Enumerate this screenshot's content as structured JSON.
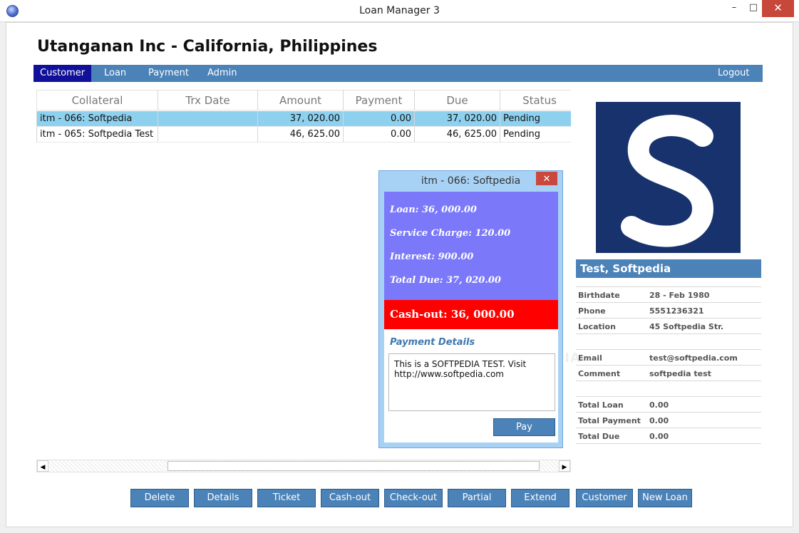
{
  "window": {
    "title": "Loan Manager 3",
    "min_glyph": "–",
    "max_glyph": "□",
    "close_glyph": "✕"
  },
  "company": "Utanganan Inc - California, Philippines",
  "nav": {
    "items": [
      "Customer",
      "Loan",
      "Payment",
      "Admin"
    ],
    "active": "Customer",
    "logout": "Logout"
  },
  "table": {
    "columns": [
      "Collateral",
      "Trx Date",
      "Amount",
      "Payment",
      "Due",
      "Status"
    ],
    "rows": [
      {
        "collateral": "itm - 066: Softpedia",
        "trx_date": "",
        "amount": "37, 020.00",
        "payment": "0.00",
        "due": "37, 020.00",
        "status": "Pending",
        "selected": true
      },
      {
        "collateral": "itm - 065: Softpedia Test",
        "trx_date": "",
        "amount": "46, 625.00",
        "payment": "0.00",
        "due": "46, 625.00",
        "status": "Pending",
        "selected": false
      }
    ]
  },
  "scrollbar": {
    "left_arrow": "◀",
    "right_arrow": "▶"
  },
  "popup": {
    "title": "itm - 066: Softpedia",
    "close_glyph": "✕",
    "loan": "Loan: 36, 000.00",
    "service_charge": "Service Charge: 120.00",
    "interest": "Interest: 900.00",
    "total_due": "Total Due: 37, 020.00",
    "cashout": "Cash-out: 36, 000.00",
    "payment_details_label": "Payment Details",
    "payment_details_text": "This is a SOFTPEDIA TEST. Visit http://www.softpedia.com",
    "pay_button": "Pay"
  },
  "customer": {
    "photo_letter": "S",
    "name": "Test, Softpedia",
    "birthdate_label": "Birthdate",
    "birthdate": "28 - Feb  1980",
    "phone_label": "Phone",
    "phone": "5551236321",
    "location_label": "Location",
    "location": "45 Softpedia Str.",
    "email_label": "Email",
    "email": "test@softpedia.com",
    "comment_label": "Comment",
    "comment": "softpedia test",
    "total_loan_label": "Total Loan",
    "total_loan": "0.00",
    "total_payment_label": "Total Payment",
    "total_payment": "0.00",
    "total_due_label": "Total Due",
    "total_due": "0.00"
  },
  "buttons": {
    "delete": "Delete",
    "details": "Details",
    "ticket": "Ticket",
    "cashout": "Cash-out",
    "checkout": "Check-out",
    "partial": "Partial",
    "extend": "Extend",
    "customer": "Customer",
    "new_loan": "New Loan"
  },
  "watermark": "SOFTPEDIA",
  "colors": {
    "accent": "#4b82b8",
    "nav_active": "#10109a",
    "selected_row": "#8ed1ef",
    "loan_box": "#7b79fa",
    "cashout_box": "#ff0000"
  },
  "icons": {
    "app": "app-globe-icon",
    "minimize": "minimize-icon",
    "maximize": "maximize-icon",
    "close": "close-icon"
  }
}
